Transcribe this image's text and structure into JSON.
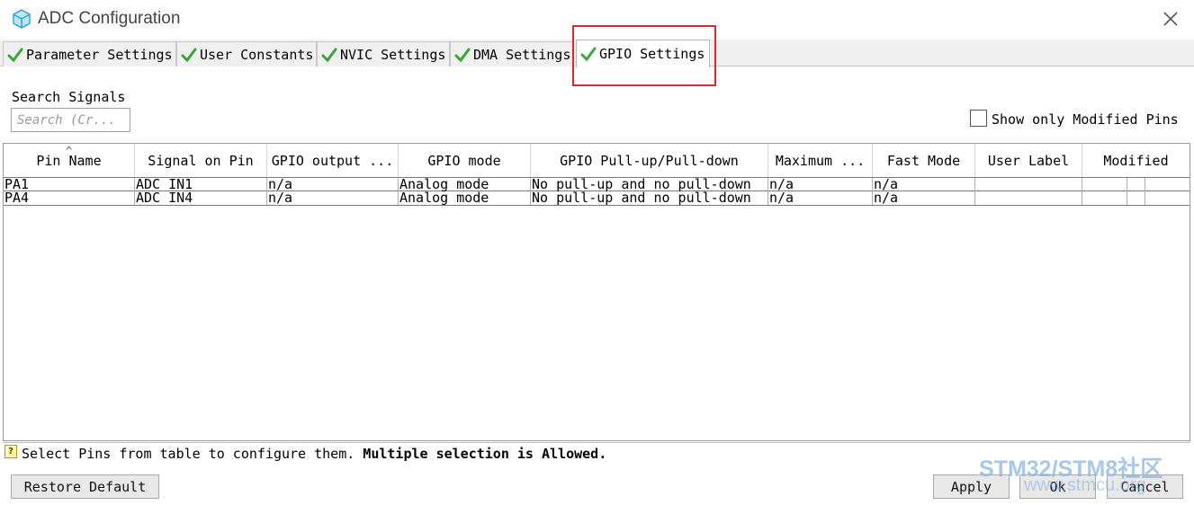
{
  "window": {
    "title": "ADC Configuration"
  },
  "tabs": [
    {
      "label": "Parameter Settings"
    },
    {
      "label": "User Constants"
    },
    {
      "label": "NVIC Settings"
    },
    {
      "label": "DMA Settings"
    },
    {
      "label": "GPIO Settings",
      "active": true
    }
  ],
  "search": {
    "label": "Search Signals",
    "placeholder": "Search (Cr..."
  },
  "filter": {
    "show_modified_label": "Show only Modified Pins",
    "checked": false
  },
  "table": {
    "columns": [
      "Pin Name",
      "Signal on Pin",
      "GPIO output ...",
      "GPIO mode",
      "GPIO Pull-up/Pull-down",
      "Maximum ...",
      "Fast Mode",
      "User Label",
      "Modified"
    ],
    "rows": [
      [
        "PA1",
        "ADC_IN1",
        "n/a",
        "Analog mode",
        "No pull-up and no pull-down",
        "n/a",
        "n/a",
        "",
        ""
      ],
      [
        "PA4",
        "ADC_IN4",
        "n/a",
        "Analog mode",
        "No pull-up and no pull-down",
        "n/a",
        "n/a",
        "",
        ""
      ]
    ]
  },
  "status": {
    "text": "Select Pins from table to configure them.",
    "bold_text": "Multiple selection is Allowed."
  },
  "buttons": {
    "restore_default": "Restore Default",
    "apply": "Apply",
    "ok": "Ok",
    "cancel": "Cancel"
  },
  "watermark": {
    "brand": "STM32/STM8社区",
    "url": "www.stmcu.org"
  },
  "colors": {
    "highlight": "#e0272d",
    "check": "#3aa53a",
    "icon": "#2aa7d6"
  },
  "icons": {
    "app": "cube-icon",
    "close": "close-icon",
    "tab": "check-icon",
    "status": "help-icon"
  }
}
